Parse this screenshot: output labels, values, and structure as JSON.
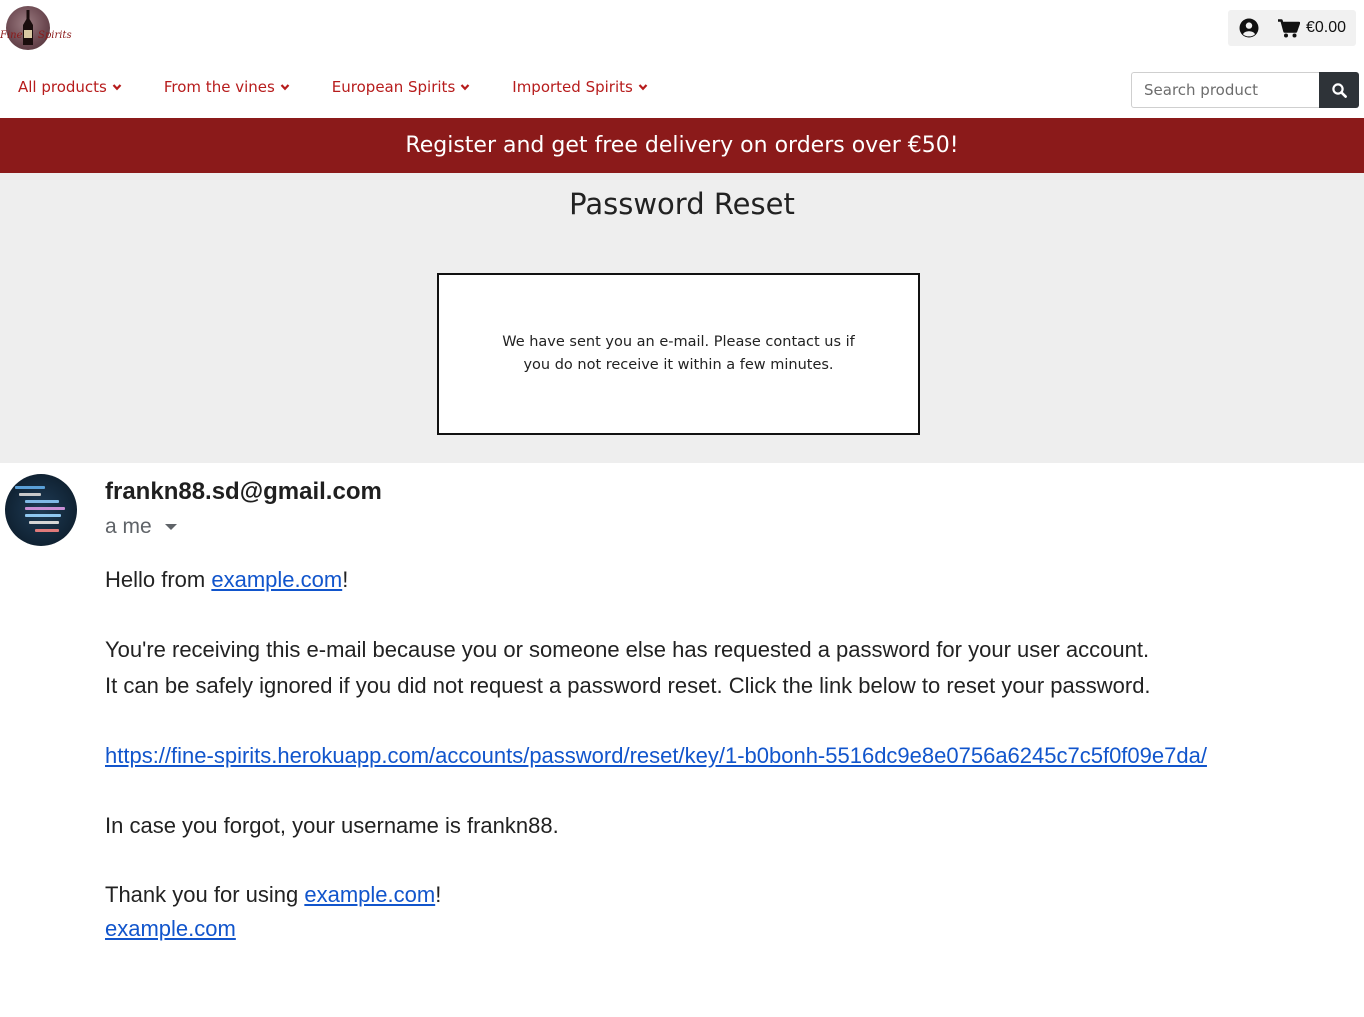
{
  "header": {
    "logo": {
      "text_left": "Fine",
      "text_right": "Spirits"
    },
    "account_icon": "user-circle-icon",
    "cart_icon": "shopping-cart-icon",
    "cart_total": "€0.00"
  },
  "nav": {
    "items": [
      {
        "label": "All products"
      },
      {
        "label": "From the vines"
      },
      {
        "label": "European Spirits"
      },
      {
        "label": "Imported Spirits"
      }
    ],
    "chevron_icon": "chevron-down-icon"
  },
  "search": {
    "placeholder": "Search product",
    "icon": "search-icon"
  },
  "banner": {
    "text": "Register and get free delivery on orders over €50!"
  },
  "reset": {
    "title": "Password Reset",
    "message": "We have sent you an e-mail. Please contact us if you do not receive it within a few minutes."
  },
  "email": {
    "sender": "frankn88.sd@gmail.com",
    "recipient": "a me",
    "greeting_prefix": "Hello from ",
    "greeting_link": "example.com",
    "greeting_suffix": "!",
    "line1": "You're receiving this e-mail because you or someone else has requested a password for your user account.",
    "line2": "It can be safely ignored if you did not request a password reset. Click the link below to reset your password.",
    "reset_link": "https://fine-spirits.herokuapp.com/accounts/password/reset/key/1-b0bonh-5516dc9e8e0756a6245c7c5f0f09e7da/",
    "username_line": "In case you forgot, your username is frankn88.",
    "thanks_prefix": "Thank you for using ",
    "thanks_link": "example.com",
    "thanks_suffix": "!",
    "signature_link": "example.com"
  },
  "colors": {
    "brand_red": "#8b1a1a",
    "nav_red": "#b71c1c",
    "link_blue": "#1155cc",
    "panel_gray": "#eeeeee"
  }
}
